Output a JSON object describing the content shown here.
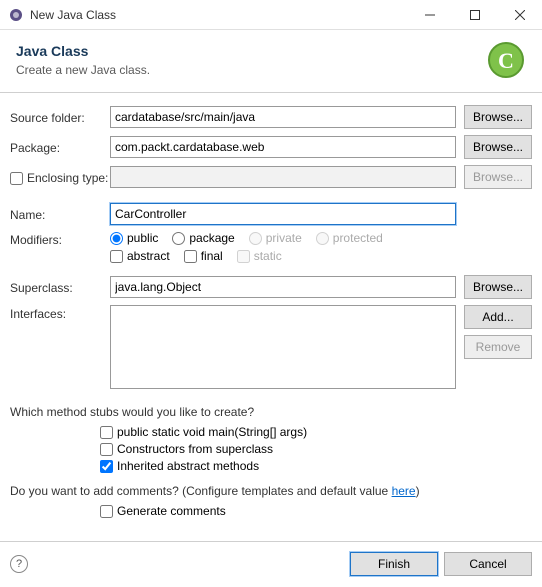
{
  "window": {
    "title": "New Java Class"
  },
  "header": {
    "title": "Java Class",
    "subtitle": "Create a new Java class."
  },
  "labels": {
    "source_folder": "Source folder:",
    "package": "Package:",
    "enclosing_type": "Enclosing type:",
    "name": "Name:",
    "modifiers": "Modifiers:",
    "superclass": "Superclass:",
    "interfaces": "Interfaces:"
  },
  "values": {
    "source_folder": "cardatabase/src/main/java",
    "package": "com.packt.cardatabase.web",
    "enclosing_type": "",
    "name": "CarController",
    "superclass": "java.lang.Object"
  },
  "buttons": {
    "browse": "Browse...",
    "add": "Add...",
    "remove": "Remove",
    "finish": "Finish",
    "cancel": "Cancel"
  },
  "modifiers": {
    "public": "public",
    "package": "package",
    "private": "private",
    "protected": "protected",
    "abstract": "abstract",
    "final": "final",
    "static": "static"
  },
  "stubs": {
    "question": "Which method stubs would you like to create?",
    "main": "public static void main(String[] args)",
    "constructors": "Constructors from superclass",
    "inherited": "Inherited abstract methods"
  },
  "comments": {
    "question_pre": "Do you want to add comments? (Configure templates and default value ",
    "link": "here",
    "question_post": ")",
    "generate": "Generate comments"
  }
}
